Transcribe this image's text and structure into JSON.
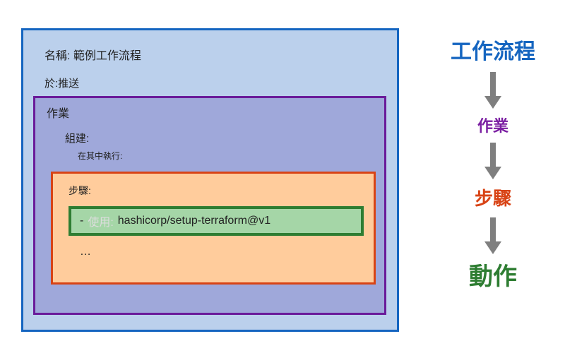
{
  "workflow": {
    "name_label": "名稱: 範例工作流程",
    "on_label": "於:推送"
  },
  "jobs": {
    "label": "作業",
    "build_label": "組建:",
    "runs_on_label": "在其中執行:"
  },
  "steps": {
    "label": "步驟:",
    "ellipsis": "…"
  },
  "action": {
    "dash": "-",
    "uses_label": "使用:",
    "reference": "hashicorp/setup-terraform@v1"
  },
  "legend": {
    "workflow": "工作流程",
    "jobs": "作業",
    "steps": "步驟",
    "action": "動作"
  },
  "colors": {
    "workflow_border": "#1565C0",
    "workflow_fill": "#BBD0EC",
    "jobs_border": "#6A1B9A",
    "jobs_fill": "#9FA8DA",
    "steps_border": "#D84315",
    "steps_fill": "#FFCC9C",
    "action_border": "#2E7D32",
    "action_fill": "#A5D6A7",
    "arrow": "#7F7F7F"
  }
}
